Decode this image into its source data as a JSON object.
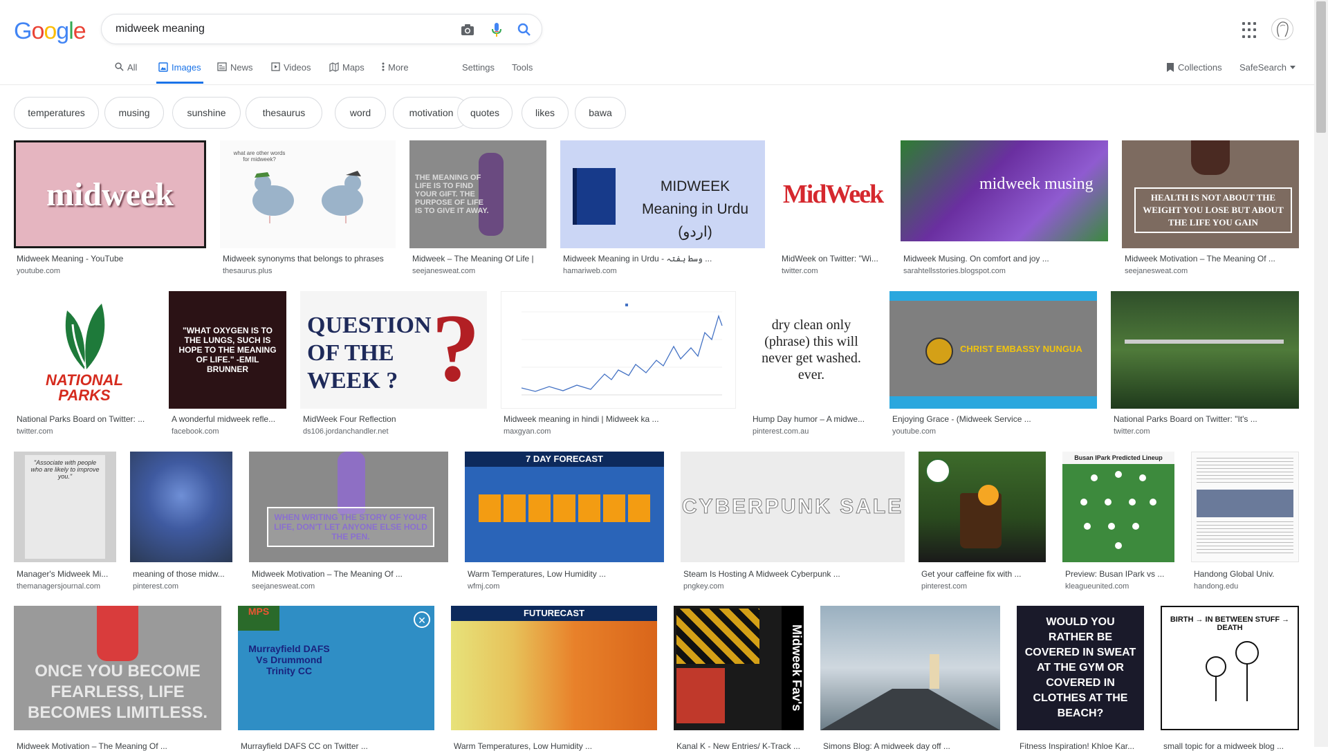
{
  "search": {
    "query": "midweek meaning"
  },
  "logo": {
    "letters": [
      "G",
      "o",
      "o",
      "g",
      "l",
      "e"
    ],
    "colors": [
      "#4285f4",
      "#ea4335",
      "#fbbc05",
      "#4285f4",
      "#34a853",
      "#ea4335"
    ]
  },
  "nav": {
    "tabs": [
      "All",
      "Images",
      "News",
      "Videos",
      "Maps",
      "More"
    ],
    "settings": "Settings",
    "tools": "Tools",
    "collections": "Collections",
    "safesearch": "SafeSearch"
  },
  "chips": [
    "temperatures",
    "musing",
    "sunshine",
    "thesaurus",
    "word",
    "motivation",
    "quotes",
    "likes",
    "bawa"
  ],
  "results": [
    {
      "title": "Midweek Meaning - YouTube",
      "source": "youtube.com",
      "caption": "midweek"
    },
    {
      "title": "Midweek synonyms that belongs to phrases",
      "source": "thesaurus.plus",
      "caption": "what are other words for midweek?"
    },
    {
      "title": "Midweek – The Meaning Of Life |",
      "source": "seejanesweat.com",
      "caption": "THE MEANING OF LIFE IS TO FIND YOUR GIFT. THE PURPOSE OF LIFE IS TO GIVE IT AWAY."
    },
    {
      "title": "Midweek Meaning in Urdu - وسط ہفتہ ...",
      "source": "hamariweb.com",
      "caption": "MIDWEEK Meaning in Urdu (اردو)"
    },
    {
      "title": "MidWeek on Twitter: \"Wi...",
      "source": "twitter.com",
      "caption": "MidWeek"
    },
    {
      "title": "Midweek Musing. On comfort and joy ...",
      "source": "sarahtellsstories.blogspot.com",
      "caption": "midweek musing"
    },
    {
      "title": "Midweek Motivation – The Meaning Of ...",
      "source": "seejanesweat.com",
      "caption": "HEALTH IS NOT ABOUT THE WEIGHT YOU LOSE BUT ABOUT THE LIFE YOU GAIN"
    },
    {
      "title": "National Parks Board on Twitter: ...",
      "source": "twitter.com",
      "caption": "NATIONAL PARKS"
    },
    {
      "title": "A wonderful midweek refle...",
      "source": "facebook.com",
      "caption": "\"WHAT OXYGEN IS TO THE LUNGS, SUCH IS HOPE TO THE MEANING OF LIFE.\" -EMIL BRUNNER"
    },
    {
      "title": "MidWeek Four Reflection",
      "source": "ds106.jordanchandler.net",
      "caption": "QUESTION OF THE WEEK ?"
    },
    {
      "title": "Midweek meaning in hindi | Midweek ka ...",
      "source": "maxgyan.com",
      "caption": ""
    },
    {
      "title": "Hump Day humor – A midwe...",
      "source": "pinterest.com.au",
      "caption": "dry clean only (phrase) this will never get washed. ever."
    },
    {
      "title": "Enjoying Grace - (Midweek Service ...",
      "source": "youtube.com",
      "caption": "CHRIST EMBASSY NUNGUA"
    },
    {
      "title": "National Parks Board on Twitter: \"It's ...",
      "source": "twitter.com",
      "caption": ""
    },
    {
      "title": "Manager's Midweek Mi...",
      "source": "themanagersjournal.com",
      "caption": "\"Associate with people who are likely to improve you.\""
    },
    {
      "title": "meaning of those midw...",
      "source": "pinterest.com",
      "caption": ""
    },
    {
      "title": "Midweek Motivation – The Meaning Of ...",
      "source": "seejanesweat.com",
      "caption": "WHEN WRITING THE STORY OF YOUR LIFE, DON'T LET ANYONE ELSE HOLD THE PEN."
    },
    {
      "title": "Warm Temperatures, Low Humidity ...",
      "source": "wfmj.com",
      "caption": "7 DAY FORECAST"
    },
    {
      "title": "Steam Is Hosting A Midweek Cyberpunk ...",
      "source": "pngkey.com",
      "caption": "CYBERPUNK SALE"
    },
    {
      "title": "Get your caffeine fix with ...",
      "source": "pinterest.com",
      "caption": ""
    },
    {
      "title": "Preview: Busan IPark vs ...",
      "source": "kleagueunited.com",
      "caption": "Busan IPark Predicted Lineup"
    },
    {
      "title": "Handong Global Univ.",
      "source": "handong.edu",
      "caption": ""
    },
    {
      "title": "Midweek Motivation – The Meaning Of ...",
      "source": "",
      "caption": "ONCE YOU BECOME FEARLESS, LIFE BECOMES LIMITLESS."
    },
    {
      "title": "Murrayfield DAFS CC on Twitter ...",
      "source": "",
      "caption": "Murrayfield DAFS Vs Drummond Trinity CC"
    },
    {
      "title": "Warm Temperatures, Low Humidity ...",
      "source": "",
      "caption": "FUTURECAST"
    },
    {
      "title": "Kanal K - New Entries/ K-Track ...",
      "source": "",
      "caption": "Midweek Fav's"
    },
    {
      "title": "Simons Blog: A midweek day off ...",
      "source": "",
      "caption": ""
    },
    {
      "title": "Fitness Inspiration! Khloe Kar...",
      "source": "",
      "caption": "WOULD YOU RATHER BE COVERED IN SWEAT AT THE GYM OR COVERED IN CLOTHES AT THE BEACH?"
    },
    {
      "title": "small topic for a midweek blog ...",
      "source": "",
      "caption": "BIRTH → IN BETWEEN STUFF → DEATH"
    }
  ]
}
